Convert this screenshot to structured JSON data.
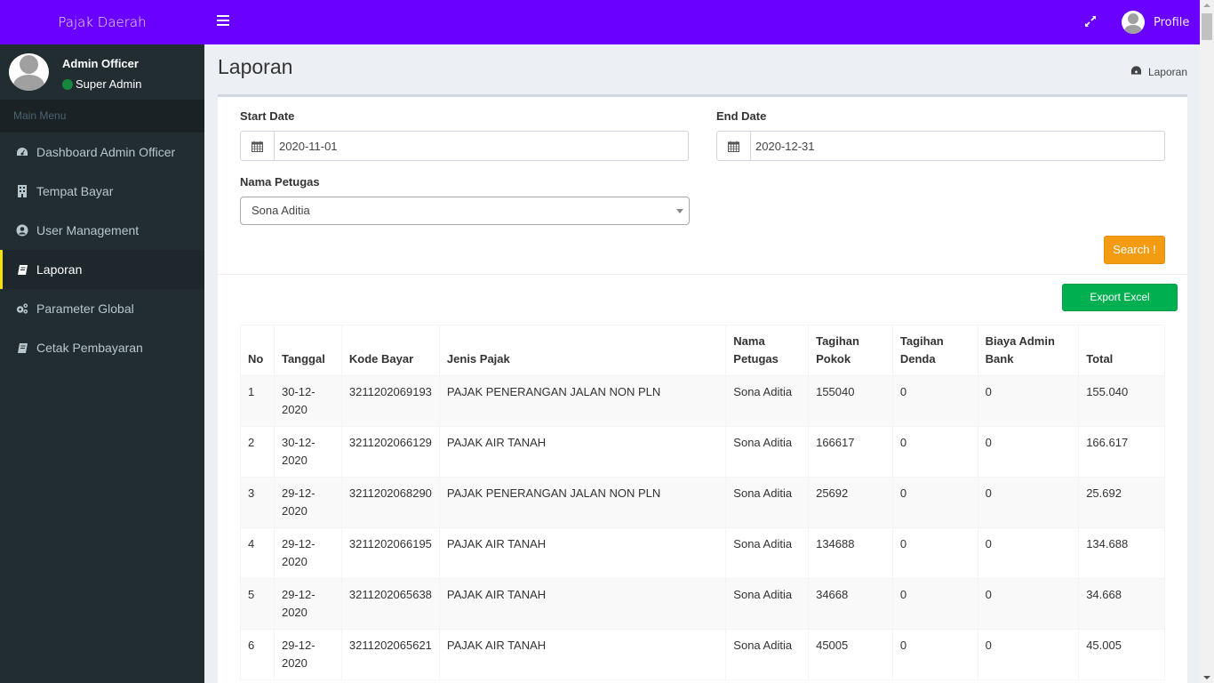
{
  "app": {
    "brand": "Pajak Daerah",
    "profile_label": "Profile"
  },
  "user": {
    "name": "Admin Officer",
    "role": "Super Admin",
    "status_color": "#18873e"
  },
  "sidebar": {
    "header": "Main Menu",
    "items": [
      {
        "label": "Dashboard Admin Officer",
        "icon": "dashboard-icon",
        "active": false
      },
      {
        "label": "Tempat Bayar",
        "icon": "building-icon",
        "active": false
      },
      {
        "label": "User Management",
        "icon": "user-circle-icon",
        "active": false
      },
      {
        "label": "Laporan",
        "icon": "book-icon",
        "active": true
      },
      {
        "label": "Parameter Global",
        "icon": "gears-icon",
        "active": false
      },
      {
        "label": "Cetak Pembayaran",
        "icon": "book-icon",
        "active": false
      }
    ]
  },
  "page": {
    "title": "Laporan",
    "breadcrumb": "Laporan"
  },
  "filters": {
    "start_date_label": "Start Date",
    "start_date": "2020-11-01",
    "end_date_label": "End Date",
    "end_date": "2020-12-31",
    "petugas_label": "Nama Petugas",
    "petugas_selected": "Sona Aditia",
    "search_label": "Search !",
    "export_label": "Export Excel"
  },
  "colors": {
    "topbar": "#6a00ff",
    "sidebar": "#222d32",
    "active_marker": "#f6e200",
    "search_button": "#f39c12",
    "export_button": "#00b050"
  },
  "table": {
    "headers": [
      "No",
      "Tanggal",
      "Kode Bayar",
      "Jenis Pajak",
      "Nama Petugas",
      "Tagihan Pokok",
      "Tagihan Denda",
      "Biaya Admin Bank",
      "Total"
    ],
    "rows": [
      [
        "1",
        "30-12-2020",
        "3211202069193",
        "PAJAK PENERANGAN JALAN NON PLN",
        "Sona Aditia",
        "155040",
        "0",
        "0",
        "155.040"
      ],
      [
        "2",
        "30-12-2020",
        "3211202066129",
        "PAJAK AIR TANAH",
        "Sona Aditia",
        "166617",
        "0",
        "0",
        "166.617"
      ],
      [
        "3",
        "29-12-2020",
        "3211202068290",
        "PAJAK PENERANGAN JALAN NON PLN",
        "Sona Aditia",
        "25692",
        "0",
        "0",
        "25.692"
      ],
      [
        "4",
        "29-12-2020",
        "3211202066195",
        "PAJAK AIR TANAH",
        "Sona Aditia",
        "134688",
        "0",
        "0",
        "134.688"
      ],
      [
        "5",
        "29-12-2020",
        "3211202065638",
        "PAJAK AIR TANAH",
        "Sona Aditia",
        "34668",
        "0",
        "0",
        "34.668"
      ],
      [
        "6",
        "29-12-2020",
        "3211202065621",
        "PAJAK AIR TANAH",
        "Sona Aditia",
        "45005",
        "0",
        "0",
        "45.005"
      ]
    ]
  }
}
